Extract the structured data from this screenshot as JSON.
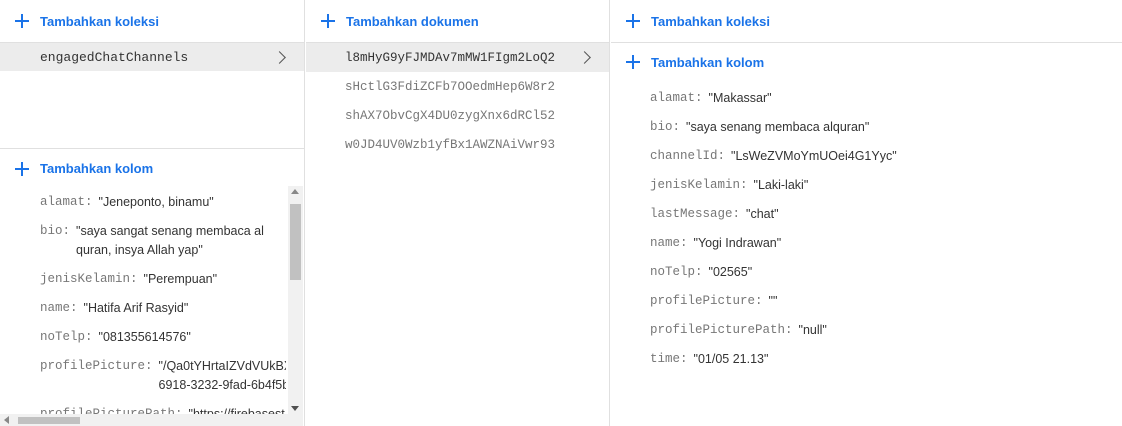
{
  "collections_panel": {
    "add_collection_label": "Tambahkan koleksi",
    "collections": [
      {
        "name": "engagedChatChannels"
      }
    ],
    "add_field_label": "Tambahkan kolom",
    "fields": [
      {
        "key": "alamat:",
        "value": "\"Jeneponto, binamu\""
      },
      {
        "key": "bio:",
        "value": "\"saya sangat senang membaca al\nquran, insya Allah yap\""
      },
      {
        "key": "jenisKelamin:",
        "value": "\"Perempuan\""
      },
      {
        "key": "name:",
        "value": "\"Hatifa Arif Rasyid\""
      },
      {
        "key": "noTelp:",
        "value": "\"081355614576\""
      },
      {
        "key": "profilePicture:",
        "value": "\"/Qa0tYHrtaIZVdVUkBX\n6918-3232-9fad-6b4f5b"
      },
      {
        "key": "profilePicturePath:",
        "value": "\"https://firebasest"
      }
    ]
  },
  "documents_panel": {
    "add_document_label": "Tambahkan dokumen",
    "documents": [
      {
        "id": "l8mHyG9yFJMDAv7mMW1FIgm2LoQ2"
      },
      {
        "id": "sHctlG3FdiZCFb7OOedmHep6W8r2"
      },
      {
        "id": "shAX7ObvCgX4DU0zygXnx6dRCl52"
      },
      {
        "id": "w0JD4UV0Wzb1yfBx1AWZNAiVwr93"
      }
    ]
  },
  "document_panel": {
    "add_collection_label": "Tambahkan koleksi",
    "add_field_label": "Tambahkan kolom",
    "fields": [
      {
        "key": "alamat:",
        "value": "\"Makassar\""
      },
      {
        "key": "bio:",
        "value": "\"saya senang membaca alquran\""
      },
      {
        "key": "channelId:",
        "value": "\"LsWeZVMoYmUOei4G1Yyc\""
      },
      {
        "key": "jenisKelamin:",
        "value": "\"Laki-laki\""
      },
      {
        "key": "lastMessage:",
        "value": "\"chat\""
      },
      {
        "key": "name:",
        "value": "\"Yogi Indrawan\""
      },
      {
        "key": "noTelp:",
        "value": "\"02565\""
      },
      {
        "key": "profilePicture:",
        "value": "\"\""
      },
      {
        "key": "profilePicturePath:",
        "value": "\"null\""
      },
      {
        "key": "time:",
        "value": "\"01/05 21.13\""
      }
    ]
  },
  "theme": {
    "accent": "#1a73e8",
    "selected_bg": "#ececec"
  }
}
